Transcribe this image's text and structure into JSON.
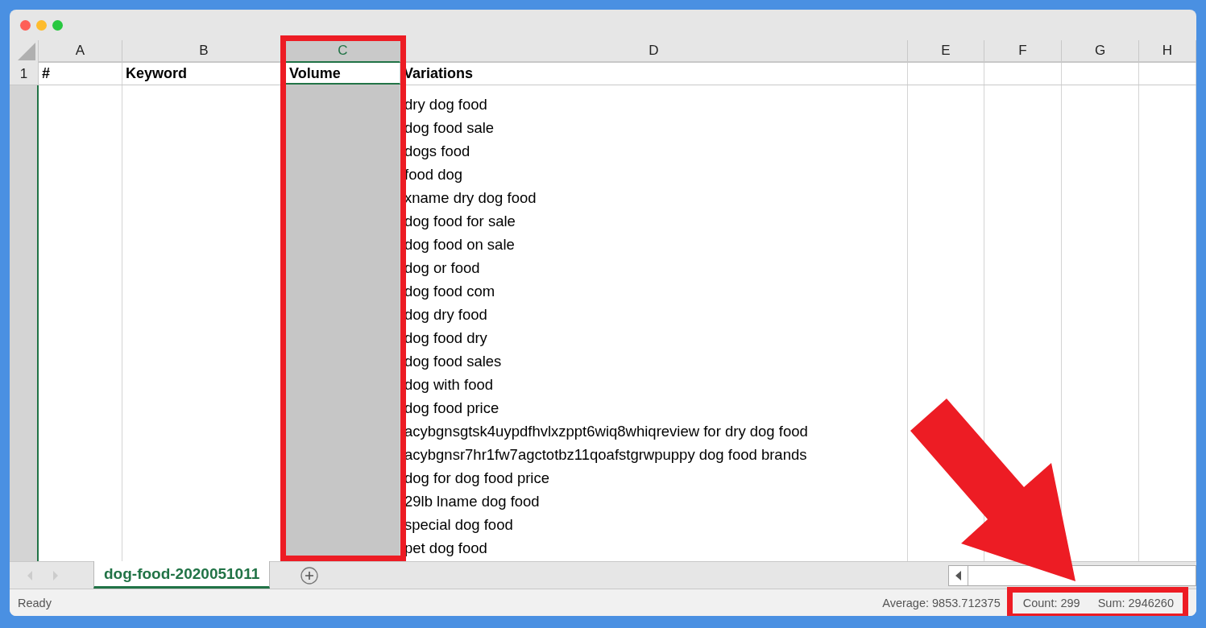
{
  "columns": [
    {
      "letter": "A",
      "heading": "#",
      "selected": false
    },
    {
      "letter": "B",
      "heading": "Keyword",
      "selected": false
    },
    {
      "letter": "C",
      "heading": "Volume",
      "selected": true
    },
    {
      "letter": "D",
      "heading": "Variations",
      "selected": false
    },
    {
      "letter": "E",
      "selected": false
    },
    {
      "letter": "F",
      "selected": false
    },
    {
      "letter": "G",
      "selected": false
    },
    {
      "letter": "H",
      "selected": false
    }
  ],
  "header_row_number": "1",
  "variations": [
    "dry dog food",
    "dog food sale",
    "dogs food",
    "food dog",
    "xname dry dog food",
    "dog food for sale",
    "dog food on sale",
    "dog or food",
    "dog food com",
    "dog dry food",
    "dog food dry",
    "dog food sales",
    "dog with food",
    "dog food price",
    "acybgnsgtsk4uypdfhvlxzppt6wiq8whiqreview for dry dog food",
    "acybgnsr7hr1fw7agctotbz11qoafstgrwpuppy dog food brands",
    "dog for dog food price",
    "29lb lname dog food",
    "special dog food",
    "pet dog food"
  ],
  "sheet_tabs": [
    {
      "label": "dog-food-2020051011",
      "selected": true
    }
  ],
  "status_bar": {
    "mode": "Ready",
    "average": "Average: 9853.712375",
    "count": "Count: 299",
    "sum": "Sum: 2946260"
  }
}
